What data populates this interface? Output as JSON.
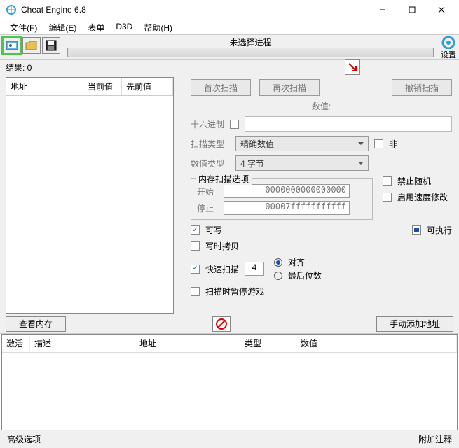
{
  "window": {
    "title": "Cheat Engine 6.8"
  },
  "menu": {
    "file": "文件(F)",
    "edit": "编辑(E)",
    "table": "表单",
    "d3d": "D3D",
    "help": "帮助(H)"
  },
  "toolbar": {
    "process_title": "未选择进程",
    "settings_label": "设置"
  },
  "results": {
    "label": "结果: 0",
    "cols": {
      "addr": "地址",
      "cur": "当前值",
      "prev": "先前值"
    }
  },
  "scan": {
    "first": "首次扫描",
    "next": "再次扫描",
    "undo": "撤销扫描",
    "value_label": "数值:",
    "hex_label": "十六进制",
    "scan_type_label": "扫描类型",
    "scan_type_value": "精确数值",
    "not_label": "非",
    "value_type_label": "数值类型",
    "value_type_value": "4 字节",
    "mem_group_title": "内存扫描选项",
    "start_label": "开始",
    "start_value": "0000000000000000",
    "stop_label": "停止",
    "stop_value": "00007fffffffffff",
    "writable": "可写",
    "executable": "可执行",
    "cow": "写时拷贝",
    "disable_random": "禁止随机",
    "enable_speed": "启用速度修改",
    "fast_scan": "快速扫描",
    "fast_scan_value": "4",
    "aligned": "对齐",
    "last_digits": "最后位数",
    "pause_on_scan": "扫描时暂停游戏"
  },
  "midbar": {
    "view_mem": "查看内存",
    "add_manual": "手动添加地址"
  },
  "addrlist": {
    "cols": {
      "active": "激活",
      "desc": "描述",
      "addr": "地址",
      "type": "类型",
      "value": "数值"
    }
  },
  "footer": {
    "advanced": "高级选项",
    "comments": "附加注释"
  }
}
